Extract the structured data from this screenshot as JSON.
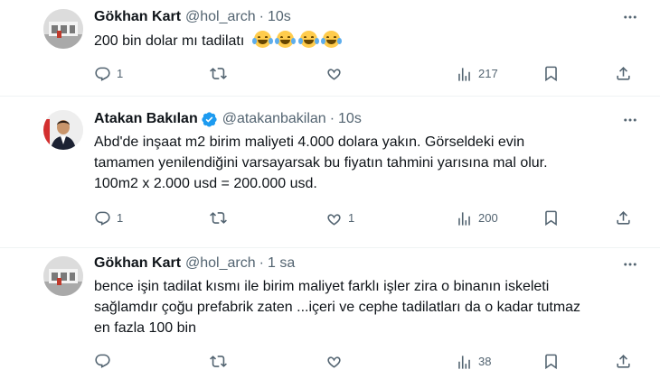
{
  "tweets": [
    {
      "name": "Gökhan Kart",
      "handle": "@hol_arch",
      "time": "10s",
      "lines": [
        "200 bin dolar mı tadilatı"
      ],
      "emoji_count": 4,
      "emoji": "face-with-tears-of-joy",
      "replies": "1",
      "retweets": "",
      "likes": "",
      "views": "217"
    },
    {
      "name": "Atakan Bakılan",
      "handle": "@atakanbakilan",
      "time": "10s",
      "verified": true,
      "lines": [
        "Abd'de inşaat m2 birim maliyeti 4.000 dolara yakın. Görseldeki evin",
        "tamamen yenilendiğini varsayarsak bu fiyatın tahmini yarısına mal olur.",
        "100m2 x 2.000 usd = 200.000 usd."
      ],
      "replies": "1",
      "retweets": "",
      "likes": "1",
      "views": "200"
    },
    {
      "name": "Gökhan Kart",
      "handle": "@hol_arch",
      "time": "1 sa",
      "lines": [
        "bence işin tadilat kısmı ile birim maliyet farklı işler zira o binanın iskeleti",
        "sağlamdır çoğu prefabrik zaten ...içeri ve cephe tadilatları da o kadar tutmaz",
        "en fazla 100 bin"
      ],
      "replies": "",
      "retweets": "",
      "likes": "",
      "views": "38"
    }
  ],
  "icons": {
    "reply": "reply-icon",
    "retweet": "retweet-icon",
    "like": "heart-icon",
    "views": "views-icon",
    "bookmark": "bookmark-icon",
    "share": "share-icon",
    "more": "more-icon",
    "verified": "verified-badge-icon"
  },
  "colors": {
    "verified": "#1d9bf0",
    "muted": "#536471",
    "text": "#0f1419"
  },
  "dot": "·"
}
